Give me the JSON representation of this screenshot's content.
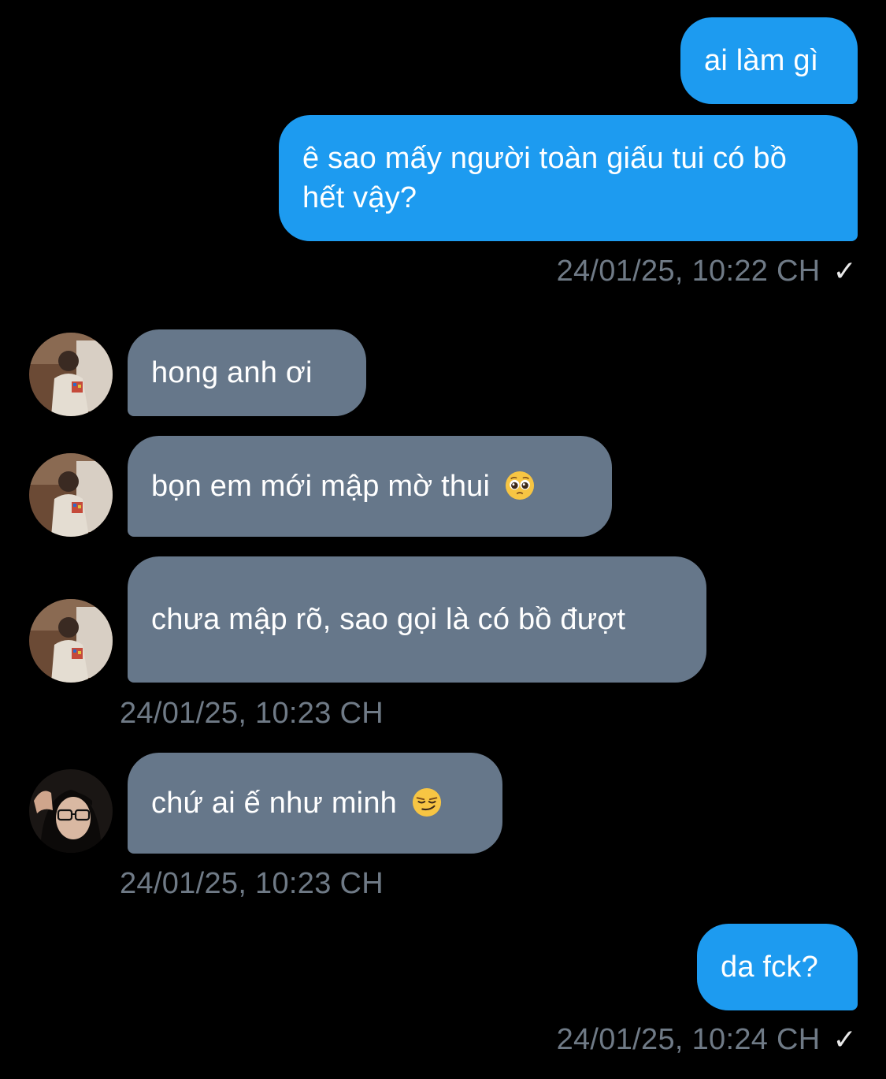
{
  "messages": [
    {
      "side": "out",
      "text": "ai làm gì"
    },
    {
      "side": "out",
      "text": "ê sao mấy người toàn giấu tui có bồ hết vậy?",
      "time": "24/01/25, 10:22 CH",
      "read": "✓"
    },
    {
      "side": "in",
      "sender": "friend-1",
      "text": "hong anh ơi"
    },
    {
      "side": "in",
      "sender": "friend-1",
      "text": "bọn em mới mập mờ thui",
      "emoji": "pleading-face"
    },
    {
      "side": "in",
      "sender": "friend-1",
      "text": "chưa mập rõ, sao gọi là có bồ đượt",
      "time": "24/01/25, 10:23 CH"
    },
    {
      "side": "in",
      "sender": "friend-2",
      "text": "chứ ai ế như minh",
      "emoji": "smirking-face",
      "time": "24/01/25, 10:23 CH"
    },
    {
      "side": "out",
      "text": "da fck?",
      "time": "24/01/25, 10:24 CH",
      "read": "✓"
    }
  ],
  "colors": {
    "background": "#000000",
    "outgoing_bubble": "#1d9bf0",
    "incoming_bubble": "#66778a",
    "timestamp": "#6f7a86"
  }
}
